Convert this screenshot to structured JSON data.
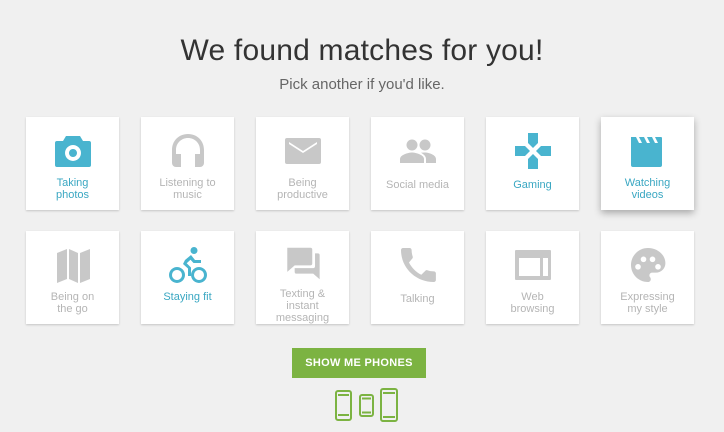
{
  "heading": "We found matches for you!",
  "subheading": "Pick another if you'd like.",
  "tiles": [
    {
      "label": "Taking\nphotos",
      "icon": "camera-icon",
      "state": "selected"
    },
    {
      "label": "Listening to\nmusic",
      "icon": "headphones-icon",
      "state": "unselected"
    },
    {
      "label": "Being\nproductive",
      "icon": "email-icon",
      "state": "unselected"
    },
    {
      "label": "Social media",
      "icon": "people-icon",
      "state": "unselected"
    },
    {
      "label": "Gaming",
      "icon": "gamepad-icon",
      "state": "selected"
    },
    {
      "label": "Watching\nvideos",
      "icon": "clapperboard-icon",
      "state": "selected"
    },
    {
      "label": "Being on\nthe go",
      "icon": "map-icon",
      "state": "unselected"
    },
    {
      "label": "Staying fit",
      "icon": "bicycle-icon",
      "state": "selected"
    },
    {
      "label": "Texting &\ninstant\nmessaging",
      "icon": "chat-icon",
      "state": "unselected"
    },
    {
      "label": "Talking",
      "icon": "phone-icon",
      "state": "unselected"
    },
    {
      "label": "Web\nbrowsing",
      "icon": "web-page-icon",
      "state": "unselected"
    },
    {
      "label": "Expressing\nmy style",
      "icon": "palette-icon",
      "state": "unselected"
    }
  ],
  "button_label": "SHOW ME PHONES",
  "colors": {
    "accent": "#49b4cf",
    "inactive": "#c8c8c8",
    "button": "#7cb342",
    "phones": "#7cb342"
  }
}
